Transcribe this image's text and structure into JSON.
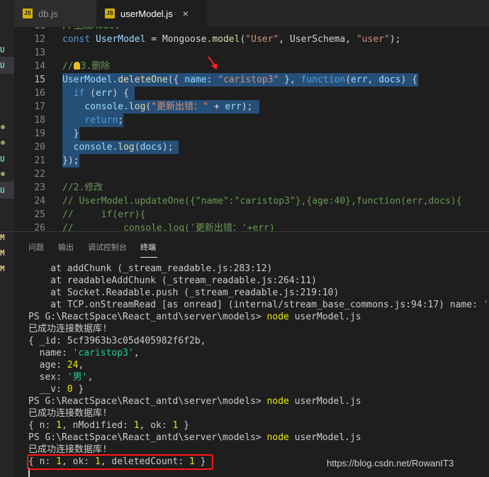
{
  "tabs": [
    {
      "label": "db.js",
      "icon": "JS"
    },
    {
      "label": "userModel.js",
      "icon": "JS",
      "close": "×"
    }
  ],
  "activity": {
    "u": "U",
    "m": "M"
  },
  "editor": {
    "line_numbers": [
      "11",
      "12",
      "13",
      "14",
      "15",
      "16",
      "17",
      "18",
      "19",
      "20",
      "21",
      "22",
      "23",
      "24",
      "25",
      "26"
    ],
    "code": {
      "l11": "//生成Model",
      "l12_a": "const",
      "l12_b": " UserModel ",
      "l12_c": "= Mongoose.",
      "l12_d": "model",
      "l12_e": "(",
      "l12_f": "\"User\"",
      "l12_g": ", UserSchema, ",
      "l12_h": "\"user\"",
      "l12_i": ");",
      "l14_a": "//",
      "l14_b": "3.删除",
      "l15_a": "UserModel.",
      "l15_b": "deleteOne",
      "l15_c": "({ ",
      "l15_d": "name",
      "l15_e": ": ",
      "l15_f": "\"caristop3\"",
      "l15_g": " }, ",
      "l15_h": "function",
      "l15_i": "(",
      "l15_j": "err",
      "l15_k": ", ",
      "l15_l": "docs",
      "l15_m": ") {",
      "l16_a": "  if ",
      "l16_b": "(",
      "l16_c": "err",
      "l16_d": ") {",
      "l17_a": "    console.",
      "l17_b": "log",
      "l17_c": "(",
      "l17_d": "\"更新出错：\"",
      "l17_e": " + ",
      "l17_f": "err",
      "l17_g": ");",
      "l18_a": "    return",
      "l18_b": ";",
      "l19": "  }",
      "l20_a": "  console.",
      "l20_b": "log",
      "l20_c": "(",
      "l20_d": "docs",
      "l20_e": ");",
      "l21": "});",
      "l23": "//2.修改",
      "l24": "// UserModel.updateOne({\"name\":\"caristop3\"},{age:40},function(err,docs){",
      "l25": "//     if(err){",
      "l26": "//         console.log('更新出错：'+err)"
    }
  },
  "panel": {
    "tabs": [
      "问题",
      "输出",
      "调试控制台",
      "终端"
    ],
    "terminal": {
      "t1": "    at addChunk (_stream_readable.js:283:12)",
      "t2": "    at readableAddChunk (_stream_readable.js:264:11)",
      "t3": "    at Socket.Readable.push (_stream_readable.js:219:10)",
      "t4a": "    at TCP.onStreamRead [as onread] (internal/stream_base_commons.js:94:17) name: ",
      "t4b": "'MongoError'",
      "prompt": "PS G:\\ReactSpace\\React_antd\\server\\models> ",
      "cmd_node": "node",
      "cmd_file": " userModel.js",
      "connected": "已成功连接数据库!",
      "doc_open": "{ _id: 5cf3963b3c05d405982f6f2b,",
      "name_k": "  name: ",
      "name_v": "'caristop3'",
      "comma": ",",
      "age_k": "  age: ",
      "age_v": "24",
      "sex_k": "  sex: ",
      "sex_v": "'男'",
      "v_k": "  __v: ",
      "v_v": "0",
      "v_close": " }",
      "upd_a": "{ n: ",
      "upd_b": "1",
      "upd_c": ", nModified: ",
      "upd_d": "1",
      "upd_e": ", ok: ",
      "upd_f": "1",
      "upd_g": " }",
      "del_a": "{ n: ",
      "del_b": "1",
      "del_c": ", ok: ",
      "del_d": "1",
      "del_e": ", deletedCount: ",
      "del_f": "1",
      "del_g": " }"
    }
  },
  "watermark": "https://blog.csdn.net/RowanIT3",
  "colors": {
    "highlight_box": "#ff1414",
    "selection": "#264f78",
    "arrow": "#ff2020"
  }
}
